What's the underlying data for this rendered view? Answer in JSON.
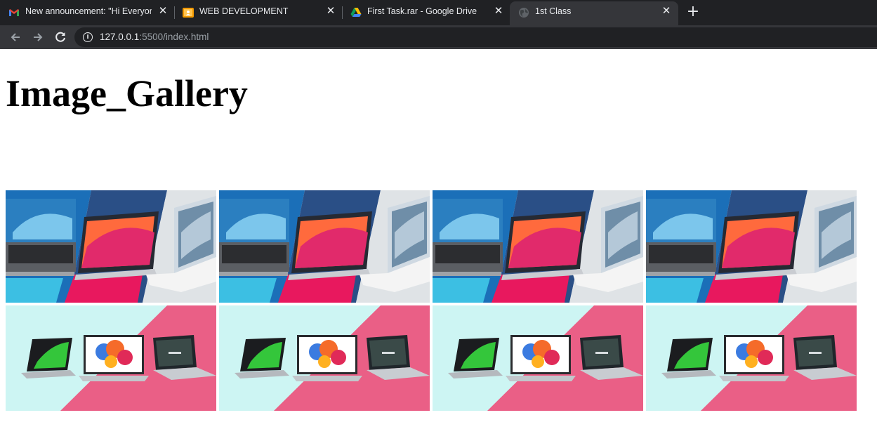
{
  "browser": {
    "tabs": [
      {
        "title": "New announcement: \"Hi Everyone",
        "icon": "gmail-icon",
        "active": false
      },
      {
        "title": "WEB DEVELOPMENT",
        "icon": "classroom-icon",
        "active": false
      },
      {
        "title": "First Task.rar - Google Drive",
        "icon": "google-drive-icon",
        "active": false
      },
      {
        "title": "1st Class",
        "icon": "globe-icon",
        "active": true
      }
    ],
    "new_tab_label": "+",
    "url_host": "127.0.0.1",
    "url_rest": ":5500/index.html"
  },
  "page": {
    "heading": "Image_Gallery",
    "gallery": {
      "rows": [
        {
          "image": "laptop-trio-blue-pink",
          "count": 4
        },
        {
          "image": "acer-laptops-teal-pink",
          "count": 4
        }
      ]
    }
  },
  "colors": {
    "tabstrip": "#202124",
    "toolbar": "#35363a",
    "teal_bg": "#cdf5f3",
    "pink_bg": "#ea5f86",
    "magenta": "#e8185e",
    "sky_blue": "#3cbfe3"
  }
}
